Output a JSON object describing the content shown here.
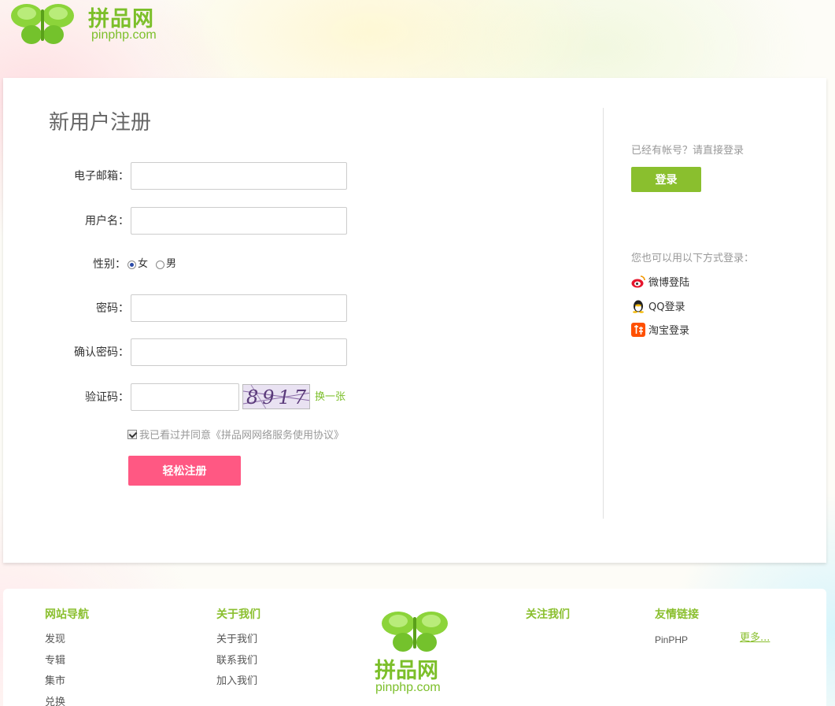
{
  "header": {
    "logo_cn": "拼品网",
    "logo_en": "pinphp.com"
  },
  "form": {
    "title": "新用户注册",
    "email_label": "电子邮箱：",
    "username_label": "用户名：",
    "gender_label": "性别：",
    "gender_female": "女",
    "gender_male": "男",
    "password_label": "密码：",
    "confirm_label": "确认密码：",
    "captcha_label": "验证码：",
    "captcha_text": "8917",
    "refresh_label": "换一张",
    "agree_text": "我已看过并同意《拼品网网络服务使用协议》",
    "submit_label": "轻松注册"
  },
  "sidebar": {
    "login_hint": "已经有帐号？请直接登录",
    "login_label": "登录",
    "other_hint": "您也可以用以下方式登录：",
    "weibo": "微博登陆",
    "qq": "QQ登录",
    "taobao": "淘宝登录"
  },
  "footer": {
    "nav_title": "网站导航",
    "nav_items": [
      "发现",
      "专辑",
      "集市",
      "兑换"
    ],
    "about_title": "关于我们",
    "about_items": [
      "关于我们",
      "联系我们",
      "加入我们"
    ],
    "follow_title": "关注我们",
    "links_title": "友情链接",
    "links_items": [
      "PinPHP"
    ],
    "more_label": "更多...",
    "logo_cn": "拼品网",
    "logo_en": "pinphp.com"
  },
  "colors": {
    "brand_green": "#7cbf2a",
    "register_pink": "#ff5883",
    "login_green": "#8abf2e"
  }
}
